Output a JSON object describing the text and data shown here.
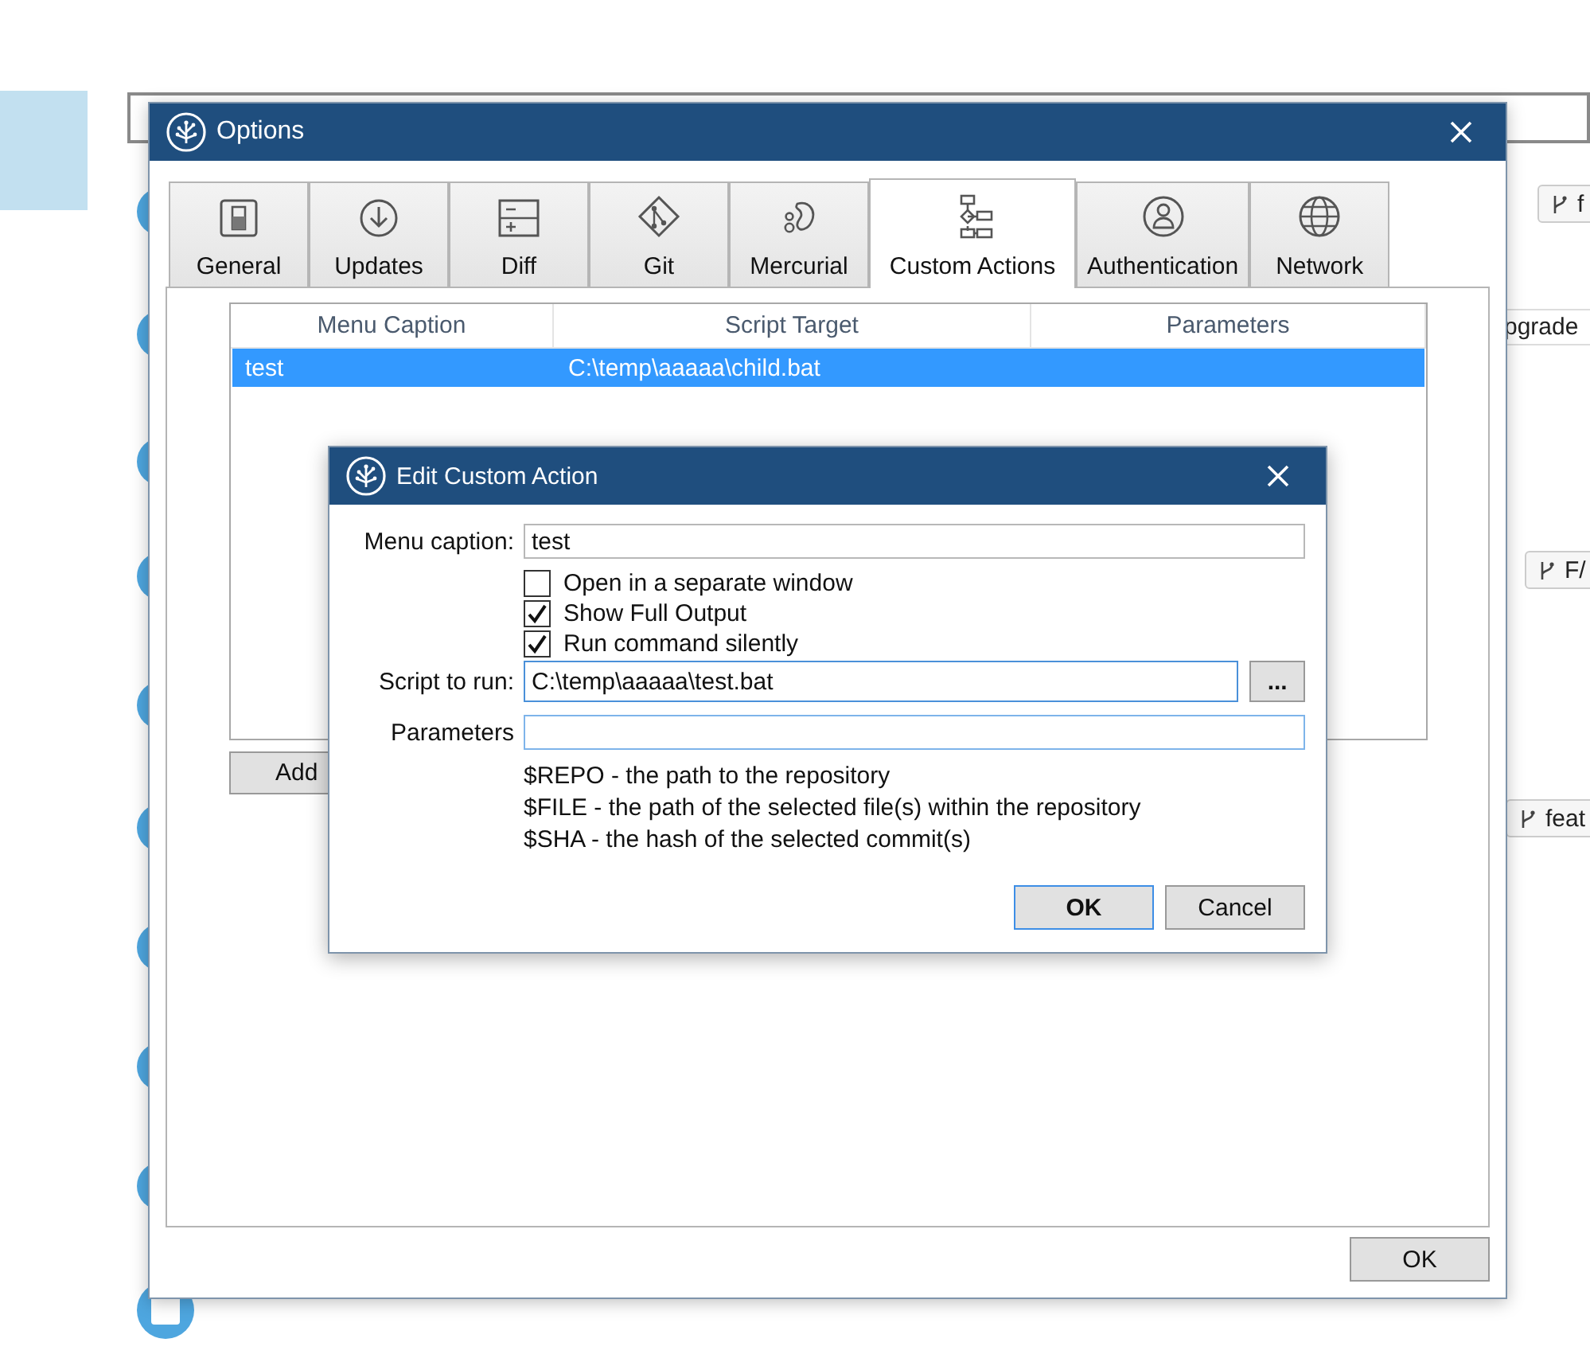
{
  "background": {
    "labels": [
      {
        "kind": "branch",
        "text": "f"
      },
      {
        "kind": "plain",
        "text": "pgrade"
      },
      {
        "kind": "branch",
        "text": "F/"
      },
      {
        "kind": "branch",
        "text": "feat"
      }
    ]
  },
  "options": {
    "title": "Options",
    "tabs": [
      {
        "label": "General",
        "selected": false
      },
      {
        "label": "Updates",
        "selected": false
      },
      {
        "label": "Diff",
        "selected": false
      },
      {
        "label": "Git",
        "selected": false
      },
      {
        "label": "Mercurial",
        "selected": false
      },
      {
        "label": "Custom Actions",
        "selected": true
      },
      {
        "label": "Authentication",
        "selected": false
      },
      {
        "label": "Network",
        "selected": false
      }
    ],
    "table": {
      "columns": [
        "Menu Caption",
        "Script Target",
        "Parameters"
      ],
      "rows": [
        {
          "menu_caption": "test",
          "script_target": "C:\\temp\\aaaaa\\child.bat",
          "selected": true
        }
      ]
    },
    "add_button": "Add",
    "ok_button": "OK"
  },
  "dialog": {
    "title": "Edit Custom Action",
    "menu_caption": {
      "label": "Menu caption:",
      "value": "test"
    },
    "checkboxes": [
      {
        "label": "Open in a separate window",
        "checked": false
      },
      {
        "label": "Show Full Output",
        "checked": true
      },
      {
        "label": "Run command silently",
        "checked": true
      }
    ],
    "script": {
      "label": "Script to run:",
      "value": "C:\\temp\\aaaaa\\test.bat",
      "browse": "..."
    },
    "parameters": {
      "label": "Parameters"
    },
    "help": [
      "$REPO - the path to the repository",
      "$FILE - the path of the selected file(s) within the repository",
      "$SHA - the hash of the selected commit(s)"
    ],
    "buttons": [
      {
        "label": "OK",
        "default": true
      },
      {
        "label": "Cancel",
        "default": false
      }
    ]
  }
}
